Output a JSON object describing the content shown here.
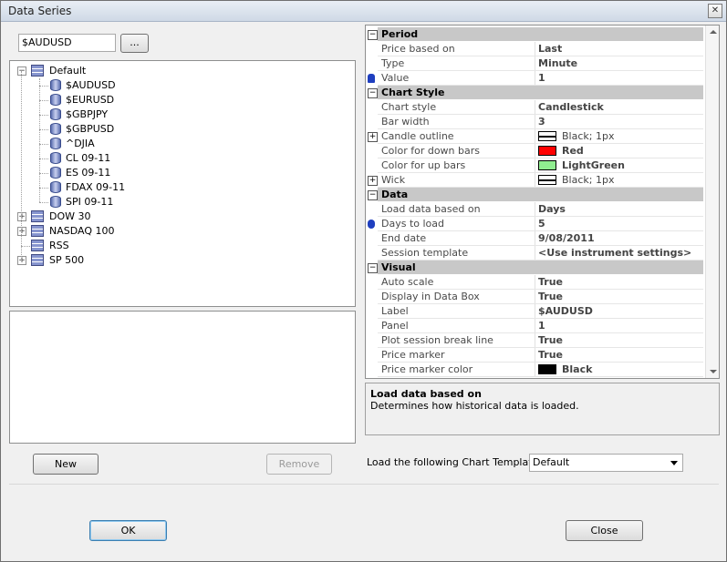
{
  "window": {
    "title": "Data Series",
    "close_glyph": "✕"
  },
  "instrument_input": {
    "value": "$AUDUSD"
  },
  "browse_button": {
    "label": "..."
  },
  "tree": {
    "groups": [
      {
        "label": "Default",
        "expanded": true,
        "items": [
          "$AUDUSD",
          "$EURUSD",
          "$GBPJPY",
          "$GBPUSD",
          "^DJIA",
          "CL 09-11",
          "ES 09-11",
          "FDAX 09-11",
          "SPI 09-11"
        ]
      },
      {
        "label": "DOW 30",
        "expanded": false
      },
      {
        "label": "NASDAQ 100",
        "expanded": false
      },
      {
        "label": "RSS",
        "expanded": false
      },
      {
        "label": "SP 500",
        "expanded": false
      }
    ]
  },
  "buttons": {
    "new": "New",
    "remove": "Remove",
    "ok": "OK",
    "close": "Close"
  },
  "properties": {
    "period": {
      "title": "Period",
      "rows": [
        [
          "Price based on",
          "Last"
        ],
        [
          "Type",
          "Minute"
        ],
        [
          "Value",
          "1"
        ]
      ]
    },
    "chart_style": {
      "title": "Chart Style",
      "rows": [
        [
          "Chart style",
          "Candlestick"
        ],
        [
          "Bar width",
          "3"
        ],
        [
          "Candle outline",
          "Black; 1px"
        ],
        [
          "Color for down bars",
          "Red"
        ],
        [
          "Color for up bars",
          "LightGreen"
        ],
        [
          "Wick",
          "Black; 1px"
        ]
      ]
    },
    "data": {
      "title": "Data",
      "rows": [
        [
          "Load data based on",
          "Days"
        ],
        [
          "Days to load",
          "5"
        ],
        [
          "End date",
          "9/08/2011"
        ],
        [
          "Session template",
          "<Use instrument settings>"
        ]
      ]
    },
    "visual": {
      "title": "Visual",
      "rows": [
        [
          "Auto scale",
          "True"
        ],
        [
          "Display in Data Box",
          "True"
        ],
        [
          "Label",
          "$AUDUSD"
        ],
        [
          "Panel",
          "1"
        ],
        [
          "Plot session break line",
          "True"
        ],
        [
          "Price marker",
          "True"
        ],
        [
          "Price marker color",
          "Black"
        ]
      ]
    }
  },
  "description": {
    "title": "Load data based on",
    "text": "Determines how historical data is loaded."
  },
  "template": {
    "label": "Load the following Chart Template:",
    "selected": "Default"
  },
  "colors": {
    "red": "#ff0000",
    "lightgreen": "#90ee90",
    "black": "#000000",
    "category_bg": "#c8c8c8"
  }
}
